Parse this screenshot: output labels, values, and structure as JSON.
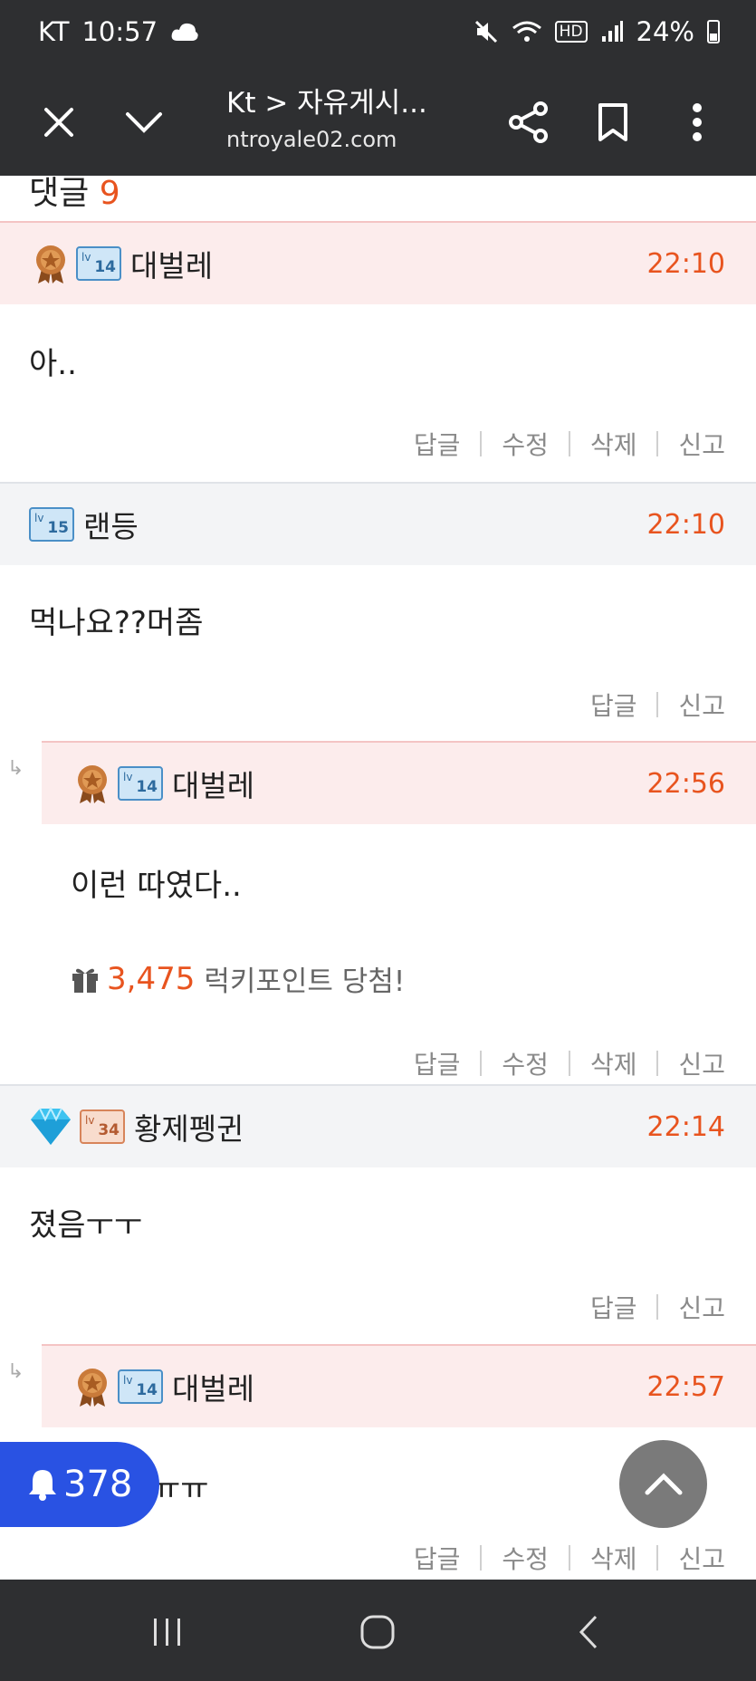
{
  "status": {
    "carrier": "KT",
    "time": "10:57",
    "hd_label": "HD",
    "battery": "24%"
  },
  "browser": {
    "title": "Kt > 자유게시...",
    "url": "ntroyale02.com"
  },
  "comments_header": {
    "label": "댓글",
    "count": "9"
  },
  "comments": [
    {
      "author": "대벌레",
      "level": "14",
      "time": "22:10",
      "body": "아..",
      "actions": [
        "답글",
        "수정",
        "삭제",
        "신고"
      ]
    },
    {
      "author": "랜등",
      "level": "15",
      "time": "22:10",
      "body": "먹나요??머좀",
      "actions": [
        "답글",
        "신고"
      ]
    },
    {
      "author": "대벌레",
      "level": "14",
      "time": "22:56",
      "body": "이런 따였다..",
      "lucky_points": "3,475",
      "lucky_text": "럭키포인트 당첨!",
      "actions": [
        "답글",
        "수정",
        "삭제",
        "신고"
      ]
    },
    {
      "author": "황제펭귄",
      "level": "34",
      "time": "22:14",
      "body": "졌음ㅜㅜ",
      "actions": [
        "답글",
        "신고"
      ]
    },
    {
      "author": "대벌레",
      "level": "14",
      "time": "22:57",
      "body": "ㅠㅠ",
      "actions": [
        "답글",
        "수정",
        "삭제",
        "신고"
      ]
    }
  ],
  "notification": {
    "count": "378"
  },
  "colors": {
    "accent": "#e8541f",
    "notif_blue": "#2952e3",
    "dark_bar": "#2e2f31"
  }
}
